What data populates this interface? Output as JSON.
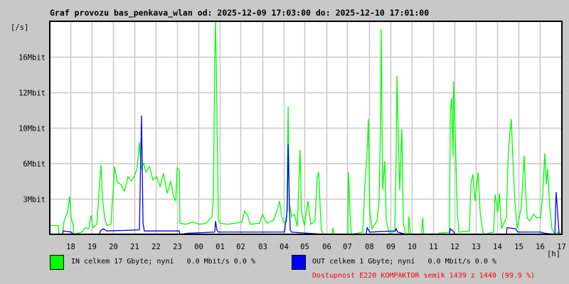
{
  "chart_data": {
    "type": "line",
    "title": "Graf provozu bas_penkava_wlan od: 2025-12-09 17:03:00 do: 2025-12-10 17:01:00",
    "ylabel": "[/s]",
    "xlabel": "[h]",
    "x_unit": "hours since 2025-12-09 17:03",
    "xlim": [
      0,
      24
    ],
    "ylim": [
      0,
      19.2
    ],
    "grid": true,
    "x_ticks": [
      {
        "label": "18",
        "h": 0.95
      },
      {
        "label": "19",
        "h": 1.95
      },
      {
        "label": "20",
        "h": 2.95
      },
      {
        "label": "21",
        "h": 3.95
      },
      {
        "label": "22",
        "h": 4.95
      },
      {
        "label": "23",
        "h": 5.95
      },
      {
        "label": "00",
        "h": 6.95
      },
      {
        "label": "01",
        "h": 7.95
      },
      {
        "label": "02",
        "h": 8.95
      },
      {
        "label": "03",
        "h": 9.95
      },
      {
        "label": "04",
        "h": 10.95
      },
      {
        "label": "05",
        "h": 11.95
      },
      {
        "label": "06",
        "h": 12.95
      },
      {
        "label": "07",
        "h": 13.95
      },
      {
        "label": "08",
        "h": 14.95
      },
      {
        "label": "09",
        "h": 15.95
      },
      {
        "label": "10",
        "h": 16.95
      },
      {
        "label": "11",
        "h": 17.95
      },
      {
        "label": "12",
        "h": 18.95
      },
      {
        "label": "13",
        "h": 19.95
      },
      {
        "label": "14",
        "h": 20.95
      },
      {
        "label": "15",
        "h": 21.95
      },
      {
        "label": "16",
        "h": 22.95
      },
      {
        "label": "17",
        "h": 23.95
      }
    ],
    "y_ticks": [
      {
        "label": "3Mbit",
        "v": 3.2
      },
      {
        "label": "6Mbit",
        "v": 6.4
      },
      {
        "label": "10Mbit",
        "v": 9.6
      },
      {
        "label": "12Mbit",
        "v": 12.8
      },
      {
        "label": "16Mbit",
        "v": 16
      }
    ],
    "series": [
      {
        "name": "IN",
        "color": "#00ff00",
        "points": [
          [
            0,
            0.8
          ],
          [
            0.4,
            0.8
          ],
          [
            0.43,
            0
          ],
          [
            0.6,
            0
          ],
          [
            0.67,
            1.2
          ],
          [
            0.83,
            2.0
          ],
          [
            0.93,
            3.4
          ],
          [
            1.0,
            1.5
          ],
          [
            1.1,
            0.8
          ],
          [
            1.13,
            0
          ],
          [
            1.5,
            0.2
          ],
          [
            1.67,
            0.6
          ],
          [
            1.83,
            0.5
          ],
          [
            1.93,
            1.7
          ],
          [
            2.03,
            0.6
          ],
          [
            2.2,
            0.9
          ],
          [
            2.27,
            2.6
          ],
          [
            2.33,
            4.5
          ],
          [
            2.4,
            6.3
          ],
          [
            2.47,
            3.2
          ],
          [
            2.57,
            1.5
          ],
          [
            2.67,
            0.8
          ],
          [
            2.87,
            0.9
          ],
          [
            2.93,
            3.0
          ],
          [
            3.0,
            4.6
          ],
          [
            3.03,
            6.1
          ],
          [
            3.17,
            4.7
          ],
          [
            3.33,
            4.5
          ],
          [
            3.5,
            3.9
          ],
          [
            3.67,
            5.2
          ],
          [
            3.83,
            4.8
          ],
          [
            4.0,
            5.4
          ],
          [
            4.1,
            6.0
          ],
          [
            4.2,
            8.3
          ],
          [
            4.27,
            5.9
          ],
          [
            4.4,
            6.4
          ],
          [
            4.5,
            5.6
          ],
          [
            4.67,
            6.1
          ],
          [
            4.83,
            4.9
          ],
          [
            5.0,
            5.2
          ],
          [
            5.17,
            4.3
          ],
          [
            5.33,
            5.5
          ],
          [
            5.5,
            3.7
          ],
          [
            5.67,
            4.8
          ],
          [
            5.8,
            3.4
          ],
          [
            5.9,
            3.0
          ],
          [
            5.97,
            6.0
          ],
          [
            6.07,
            5.8
          ],
          [
            6.1,
            1.0
          ],
          [
            6.37,
            0.9
          ],
          [
            6.7,
            1.1
          ],
          [
            7.0,
            0.9
          ],
          [
            7.33,
            1.0
          ],
          [
            7.6,
            1.6
          ],
          [
            7.67,
            3.4
          ],
          [
            7.73,
            16
          ],
          [
            7.77,
            19.2
          ],
          [
            7.83,
            11.5
          ],
          [
            7.9,
            1.3
          ],
          [
            8.0,
            1.0
          ],
          [
            8.33,
            0.9
          ],
          [
            8.67,
            1.0
          ],
          [
            9.0,
            1.1
          ],
          [
            9.13,
            2.1
          ],
          [
            9.27,
            1.7
          ],
          [
            9.4,
            0.9
          ],
          [
            9.83,
            1.0
          ],
          [
            9.97,
            1.8
          ],
          [
            10.17,
            1.0
          ],
          [
            10.5,
            1.3
          ],
          [
            10.67,
            2.3
          ],
          [
            10.77,
            3.0
          ],
          [
            10.87,
            1.6
          ],
          [
            11.0,
            1.0
          ],
          [
            11.1,
            1.2
          ],
          [
            11.13,
            5.0
          ],
          [
            11.17,
            11.5
          ],
          [
            11.23,
            2.8
          ],
          [
            11.33,
            1.6
          ],
          [
            11.47,
            1.8
          ],
          [
            11.6,
            0.7
          ],
          [
            11.73,
            7.6
          ],
          [
            11.8,
            2.0
          ],
          [
            11.93,
            0.8
          ],
          [
            12.1,
            3.0
          ],
          [
            12.23,
            0.9
          ],
          [
            12.43,
            1.2
          ],
          [
            12.53,
            5.1
          ],
          [
            12.6,
            5.6
          ],
          [
            12.67,
            2.5
          ],
          [
            12.73,
            0.4
          ],
          [
            12.83,
            0
          ],
          [
            13.23,
            0
          ],
          [
            13.27,
            0.6
          ],
          [
            13.33,
            0
          ],
          [
            13.97,
            0
          ],
          [
            14.0,
            5.6
          ],
          [
            14.07,
            2.0
          ],
          [
            14.13,
            0
          ],
          [
            14.67,
            0.2
          ],
          [
            14.77,
            4.5
          ],
          [
            14.87,
            7.3
          ],
          [
            14.93,
            10.4
          ],
          [
            15.0,
            2.0
          ],
          [
            15.1,
            0.5
          ],
          [
            15.33,
            1.2
          ],
          [
            15.43,
            3.0
          ],
          [
            15.5,
            10.0
          ],
          [
            15.53,
            18.5
          ],
          [
            15.6,
            4.0
          ],
          [
            15.7,
            6.6
          ],
          [
            15.77,
            1.2
          ],
          [
            15.93,
            0
          ],
          [
            16.17,
            0.3
          ],
          [
            16.23,
            6.5
          ],
          [
            16.27,
            14.3
          ],
          [
            16.33,
            9.0
          ],
          [
            16.4,
            4.0
          ],
          [
            16.5,
            9.5
          ],
          [
            16.57,
            1.0
          ],
          [
            16.67,
            0
          ],
          [
            16.8,
            0
          ],
          [
            16.83,
            1.6
          ],
          [
            16.9,
            0
          ],
          [
            17.43,
            0
          ],
          [
            17.47,
            1.5
          ],
          [
            17.53,
            0
          ],
          [
            18.2,
            0
          ],
          [
            18.23,
            0.1
          ],
          [
            18.73,
            0.2
          ],
          [
            18.77,
            11.0
          ],
          [
            18.83,
            12.3
          ],
          [
            18.9,
            7.0
          ],
          [
            18.93,
            13.8
          ],
          [
            19.0,
            9.0
          ],
          [
            19.1,
            2.0
          ],
          [
            19.17,
            0.2
          ],
          [
            19.67,
            0.3
          ],
          [
            19.73,
            4.5
          ],
          [
            19.83,
            5.4
          ],
          [
            19.93,
            3.0
          ],
          [
            20.07,
            5.6
          ],
          [
            20.17,
            2.0
          ],
          [
            20.27,
            0.5
          ],
          [
            20.33,
            0
          ],
          [
            20.8,
            0.2
          ],
          [
            20.87,
            3.6
          ],
          [
            21.0,
            2.0
          ],
          [
            21.07,
            3.7
          ],
          [
            21.17,
            0.5
          ],
          [
            21.4,
            1.5
          ],
          [
            21.47,
            6.4
          ],
          [
            21.53,
            8.5
          ],
          [
            21.63,
            10.4
          ],
          [
            21.7,
            6.9
          ],
          [
            21.8,
            3.0
          ],
          [
            21.9,
            0.5
          ],
          [
            22.1,
            2.5
          ],
          [
            22.23,
            7.1
          ],
          [
            22.3,
            4.0
          ],
          [
            22.37,
            1.5
          ],
          [
            22.5,
            1.2
          ],
          [
            22.67,
            1.8
          ],
          [
            22.83,
            1.5
          ],
          [
            23.0,
            1.5
          ],
          [
            23.1,
            3.6
          ],
          [
            23.2,
            7.3
          ],
          [
            23.27,
            4.5
          ],
          [
            23.33,
            5.9
          ],
          [
            23.43,
            2.5
          ],
          [
            23.53,
            0.5
          ],
          [
            23.67,
            0
          ],
          [
            23.83,
            0.2
          ],
          [
            24.0,
            0
          ]
        ]
      },
      {
        "name": "OUT",
        "color": "#0000ff",
        "points": [
          [
            0,
            0
          ],
          [
            0.6,
            0
          ],
          [
            0.63,
            0.3
          ],
          [
            1.0,
            0.2
          ],
          [
            1.1,
            0
          ],
          [
            2.33,
            0
          ],
          [
            2.37,
            0.3
          ],
          [
            2.5,
            0.5
          ],
          [
            2.67,
            0.3
          ],
          [
            4.2,
            0.4
          ],
          [
            4.23,
            3.5
          ],
          [
            4.3,
            10.7
          ],
          [
            4.37,
            1.0
          ],
          [
            4.43,
            0.3
          ],
          [
            6.07,
            0.3
          ],
          [
            6.1,
            0
          ],
          [
            6.5,
            0.1
          ],
          [
            7.73,
            0.2
          ],
          [
            7.77,
            1.2
          ],
          [
            7.83,
            0.4
          ],
          [
            7.9,
            0.2
          ],
          [
            11.0,
            0.2
          ],
          [
            11.13,
            2.2
          ],
          [
            11.17,
            8.1
          ],
          [
            11.23,
            2.5
          ],
          [
            11.27,
            0.4
          ],
          [
            11.33,
            0.2
          ],
          [
            12.83,
            0
          ],
          [
            14.83,
            0
          ],
          [
            14.87,
            0.6
          ],
          [
            15.0,
            0.2
          ],
          [
            16.2,
            0.3
          ],
          [
            16.23,
            0.5
          ],
          [
            16.3,
            0.2
          ],
          [
            16.5,
            0.1
          ],
          [
            16.67,
            0
          ],
          [
            18.73,
            0
          ],
          [
            18.77,
            0.5
          ],
          [
            18.9,
            0.3
          ],
          [
            19.0,
            0
          ],
          [
            21.4,
            0
          ],
          [
            21.43,
            0.6
          ],
          [
            21.83,
            0.5
          ],
          [
            21.93,
            0.2
          ],
          [
            23.0,
            0.2
          ],
          [
            23.17,
            0.1
          ],
          [
            23.67,
            0
          ],
          [
            23.73,
            3.8
          ],
          [
            23.8,
            2.0
          ],
          [
            23.87,
            0
          ],
          [
            24.0,
            0
          ]
        ]
      }
    ]
  },
  "legend": {
    "in_text": "IN celkem 17 Gbyte; nyní   0.0 Mbit/s 0.0 %",
    "out_text": "OUT celkem 1 Gbyte; nyní   0.0 Mbit/s 0.0 %",
    "in_color": "#00ff00",
    "out_color": "#0000ff",
    "availability": "Dostupnost E220 KOMPAKTOR semik 1439 z 1440 (99.9 %)"
  }
}
